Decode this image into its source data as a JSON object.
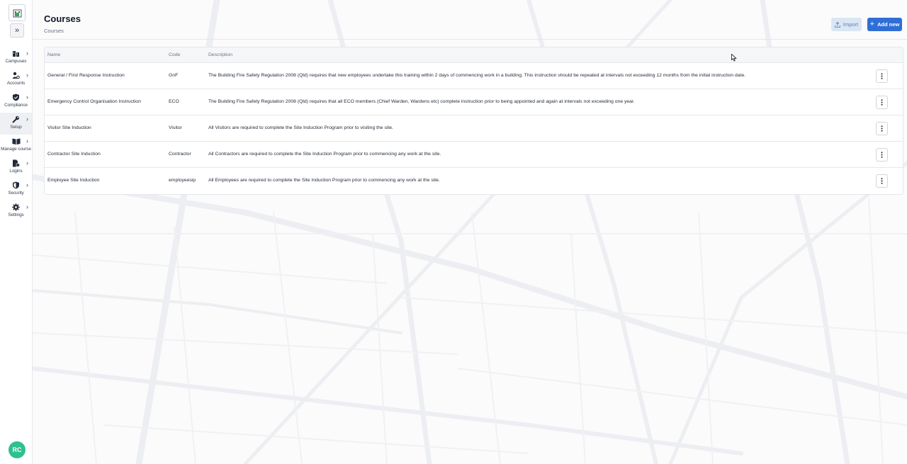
{
  "sidebar": {
    "expand_label": "»",
    "items": [
      {
        "label": "Campuses",
        "icon": "building-icon",
        "active": false
      },
      {
        "label": "Accounts",
        "icon": "user-gear-icon",
        "active": false
      },
      {
        "label": "Compliance",
        "icon": "shield-check-icon",
        "active": false
      },
      {
        "label": "Setup",
        "icon": "wrench-icon",
        "active": true
      },
      {
        "label": "Manage course",
        "icon": "book-icon",
        "active": false
      },
      {
        "label": "Logins",
        "icon": "lock-file-icon",
        "active": false
      },
      {
        "label": "Security",
        "icon": "shield-icon",
        "active": false
      },
      {
        "label": "Settings",
        "icon": "gear-icon",
        "active": false
      }
    ],
    "avatar_initials": "RC"
  },
  "header": {
    "title": "Courses",
    "breadcrumb": "Courses",
    "import_label": "Import",
    "add_label": "Add new"
  },
  "table": {
    "columns": [
      "Name",
      "Code",
      "Description"
    ],
    "rows": [
      {
        "name": "General / First Response Instruction",
        "code": "GnF",
        "description": "The Building Fire Safety Regulation 2008 (Qld) requires that new employees undertake this training within 2 days of commencing work in a building. This instruction should be repeated at intervals not exceeding 12 months from the initial instruction date."
      },
      {
        "name": "Emergency Control Organisation Instruction",
        "code": "ECO",
        "description": "The Building Fire Safety Regulation 2008 (Qld) requires that all ECO members (Chief Warden, Wardens etc) complete instruction prior to being appointed and again at intervals not exceeding one year."
      },
      {
        "name": "Visitor Site Induction",
        "code": "Visitor",
        "description": "All Visitors are required to complete the Site Induction Program prior to visiting the site."
      },
      {
        "name": "Contractor Site Induction",
        "code": "Contractor",
        "description": "All Contractors are required to complete the Site Induction Program prior to commencing any work at the site."
      },
      {
        "name": "Employee Site Induction",
        "code": "employeesip",
        "description": "All Employees are required to complete the Site Induction Program prior to commencing any work at the site."
      }
    ]
  },
  "colors": {
    "primary": "#2f6ed6",
    "import_bg": "#dbe6f4",
    "avatar": "#2ec08f",
    "active_nav": "#eef0f3"
  }
}
